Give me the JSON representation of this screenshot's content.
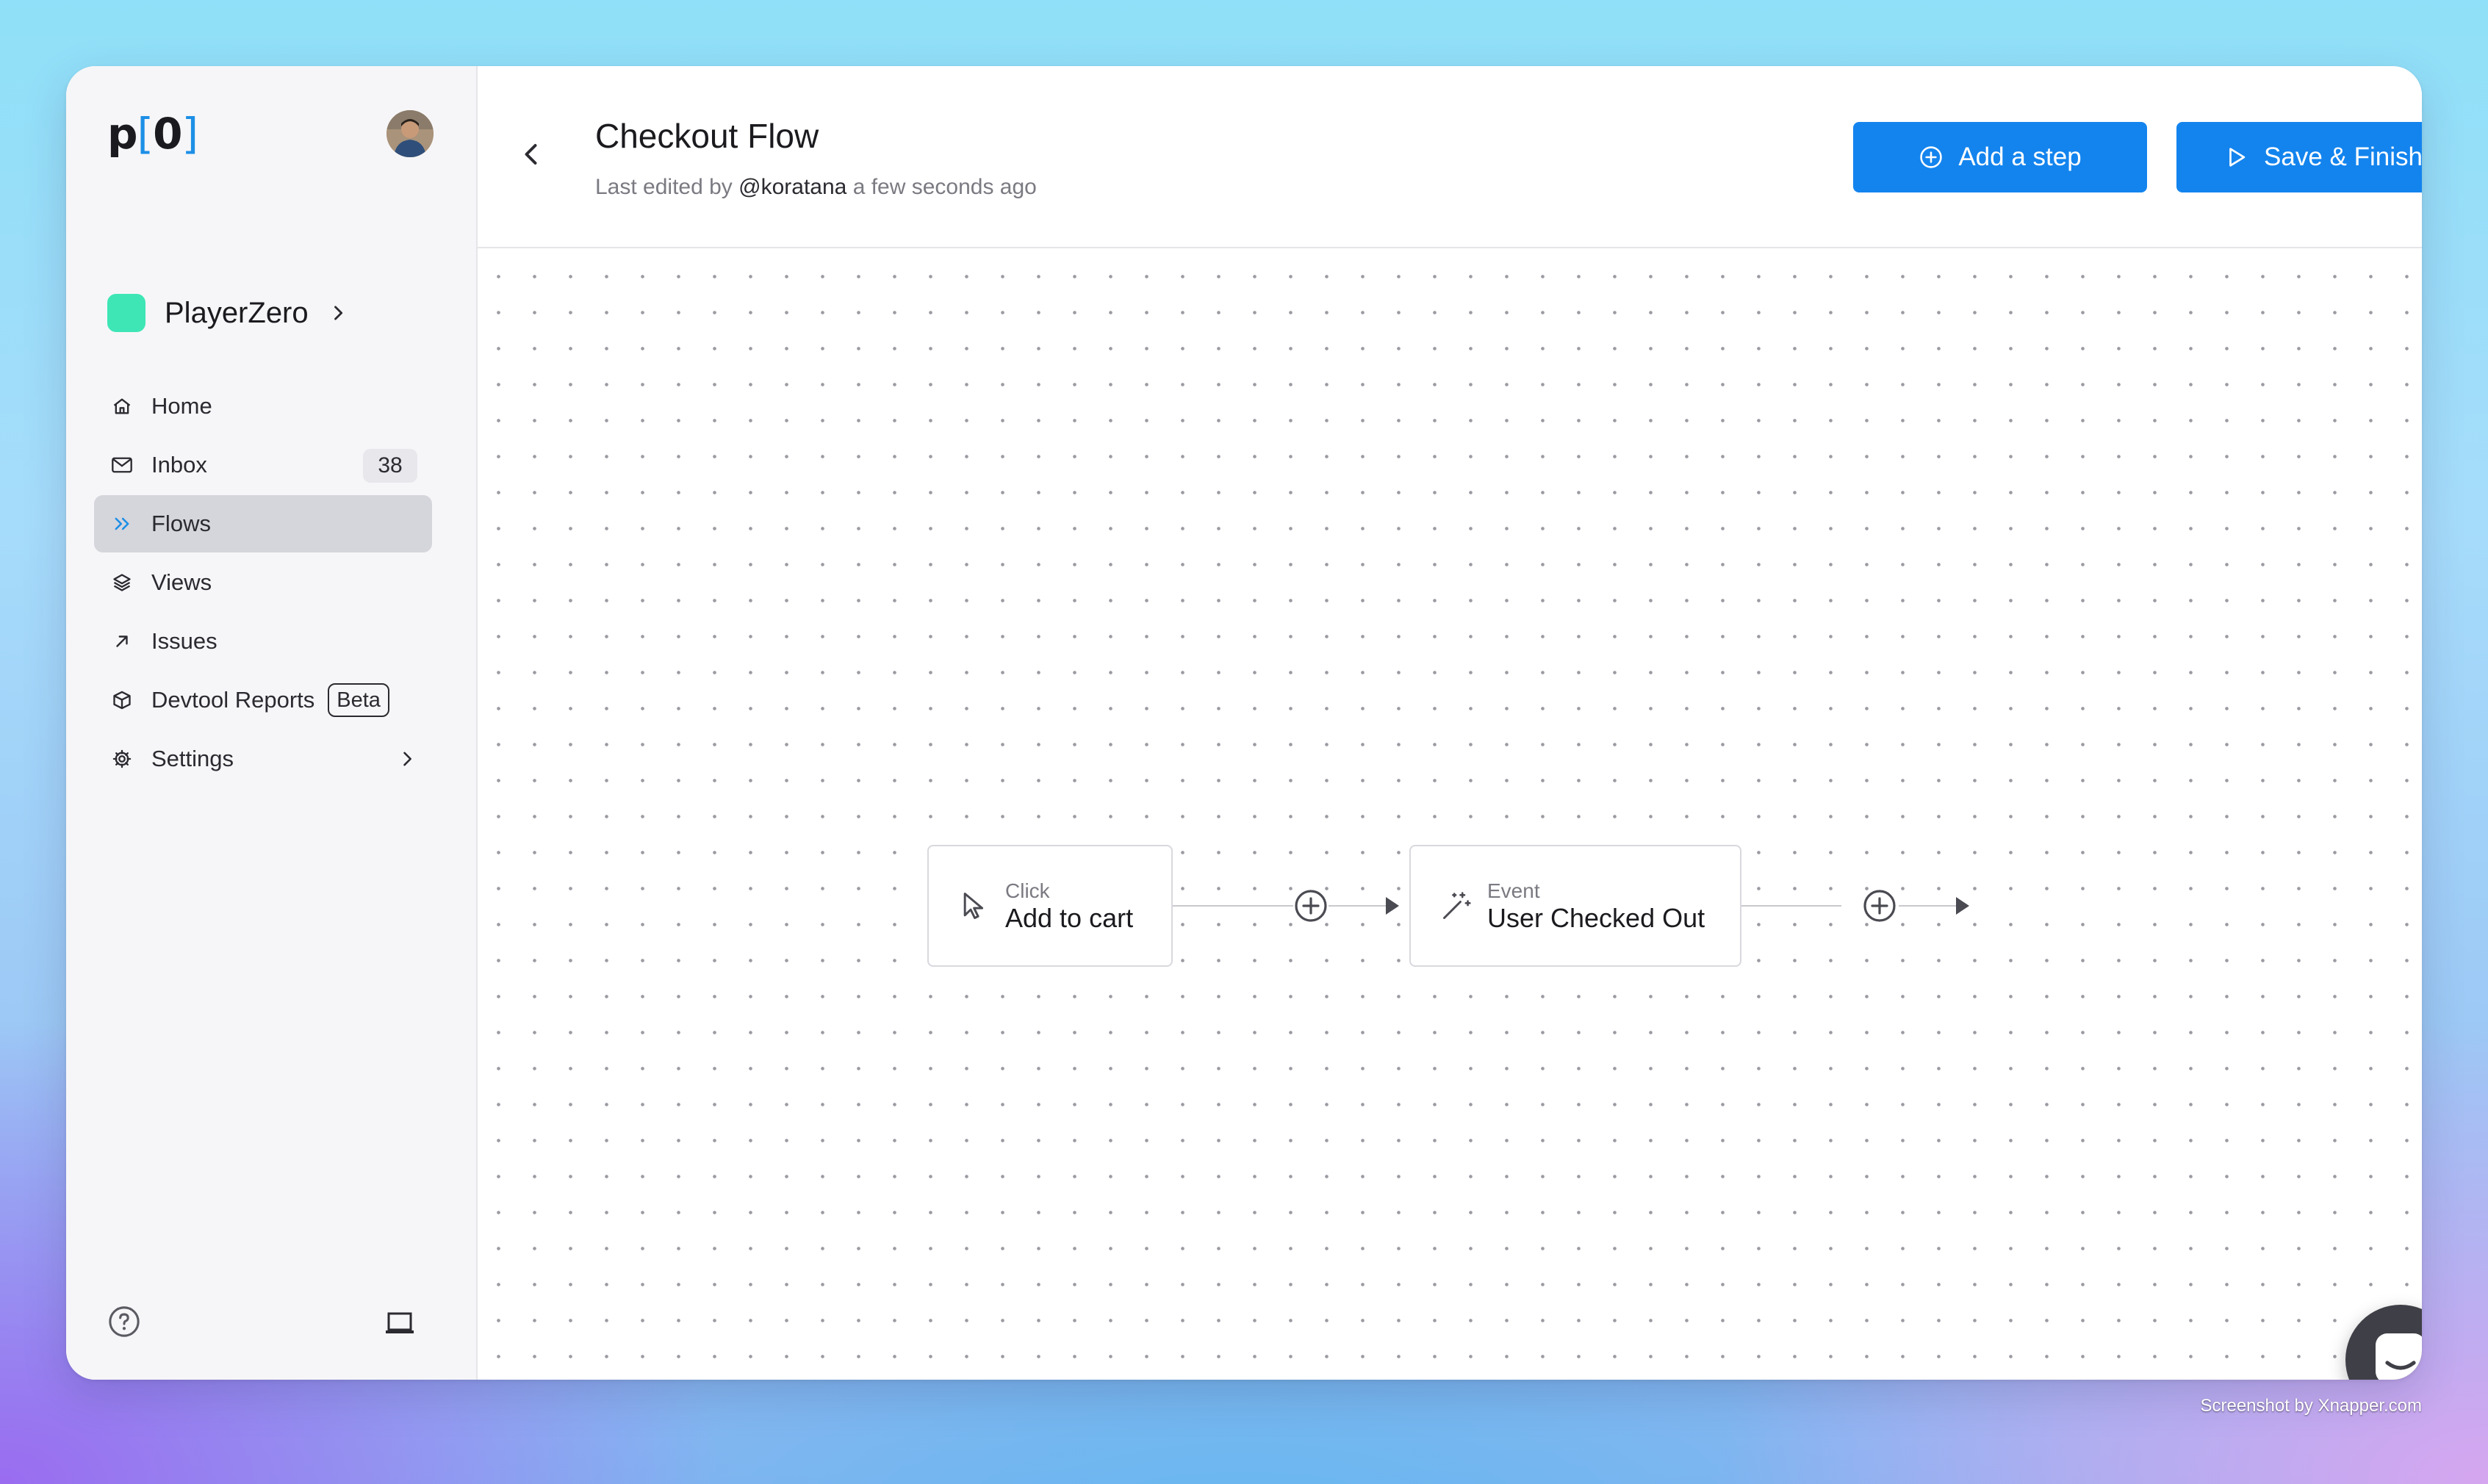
{
  "app": {
    "logo_text": "p[0]",
    "workspace_name": "PlayerZero"
  },
  "sidebar": {
    "items": [
      {
        "label": "Home",
        "icon": "home-icon"
      },
      {
        "label": "Inbox",
        "icon": "inbox-icon",
        "count": "38"
      },
      {
        "label": "Flows",
        "icon": "flows-icon",
        "active": true
      },
      {
        "label": "Views",
        "icon": "layers-icon"
      },
      {
        "label": "Issues",
        "icon": "arrow-up-right-icon"
      },
      {
        "label": "Devtool Reports",
        "icon": "cube-icon",
        "badge": "Beta"
      },
      {
        "label": "Settings",
        "icon": "gear-icon"
      }
    ],
    "footer_icons": [
      "help-icon",
      "device-icon"
    ]
  },
  "header": {
    "title": "Checkout Flow",
    "subtitle_prefix": "Last edited by",
    "subtitle_user": "@koratana",
    "subtitle_suffix": "a few seconds ago",
    "add_step_label": "Add a step",
    "save_label": "Save & Finish"
  },
  "flow": {
    "steps": [
      {
        "type": "Click",
        "label": "Add to cart",
        "icon": "cursor-icon"
      },
      {
        "type": "Event",
        "label": "User Checked Out",
        "icon": "magic-wand-icon"
      }
    ]
  },
  "colors": {
    "accent": "#1384ee",
    "workspace": "#3ee6b5",
    "sidebar_active": "#d5d5dc"
  },
  "watermark": "Screenshot by Xnapper.com"
}
